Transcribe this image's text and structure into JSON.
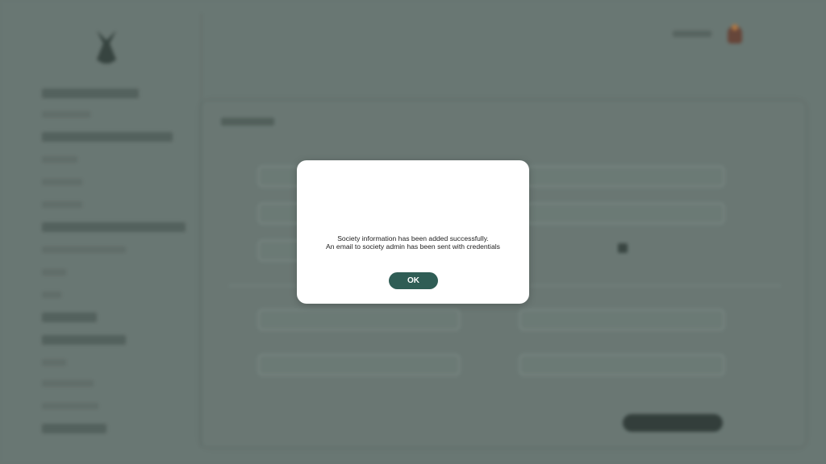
{
  "modal": {
    "message_line1": "Society information has been added successfully.",
    "message_line2": "An email to society admin has been sent with credentials",
    "ok_label": "OK"
  },
  "colors": {
    "accent": "#2f5d55",
    "overlay": "#6b7a76",
    "modal_bg": "#ffffff"
  }
}
